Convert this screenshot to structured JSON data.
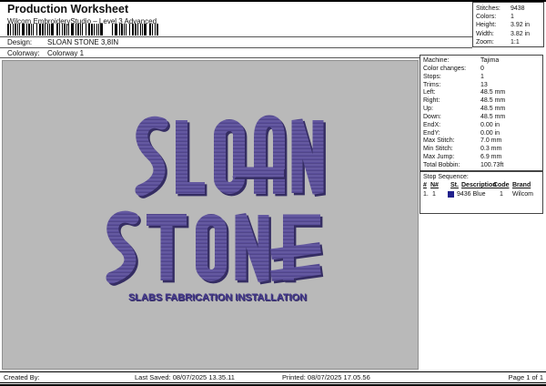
{
  "header": {
    "title": "Production Worksheet",
    "subtitle": "Wilcom EmbroideryStudio – Level 3 Advanced",
    "design_label": "Design:",
    "design_value": "SLOAN STONE 3,8IN",
    "colorway_label": "Colorway:",
    "colorway_value": "Colorway 1"
  },
  "stats_box": {
    "rows": [
      {
        "label": "Stitches:",
        "value": "9438"
      },
      {
        "label": "Colors:",
        "value": "1"
      },
      {
        "label": "Height:",
        "value": "3.92 in"
      },
      {
        "label": "Width:",
        "value": "3.82 in"
      },
      {
        "label": "Zoom:",
        "value": "1:1"
      }
    ]
  },
  "machine_panel": {
    "rows": [
      {
        "label": "Machine:",
        "value": "Tajima"
      },
      {
        "label": "Color changes:",
        "value": "0"
      },
      {
        "label": "Stops:",
        "value": "1"
      },
      {
        "label": "Trims:",
        "value": "13"
      },
      {
        "label": "Left:",
        "value": "48.5 mm"
      },
      {
        "label": "Right:",
        "value": "48.5 mm"
      },
      {
        "label": "Up:",
        "value": "48.5 mm"
      },
      {
        "label": "Down:",
        "value": "48.5 mm"
      },
      {
        "label": "EndX:",
        "value": "0.00 in"
      },
      {
        "label": "EndY:",
        "value": "0.00 in"
      },
      {
        "label": "Max Stitch:",
        "value": "7.0 mm"
      },
      {
        "label": "Min Stitch:",
        "value": "0.3 mm"
      },
      {
        "label": "Max Jump:",
        "value": "6.9 mm"
      },
      {
        "label": "Total Bobbin:",
        "value": "100.73ft"
      }
    ]
  },
  "stop_sequence": {
    "title": "Stop Sequence:",
    "columns": [
      "#",
      "N#",
      "St.",
      "Description",
      "Code",
      "Brand"
    ],
    "row": {
      "index": "1.",
      "needle": "1",
      "swatch_color": "#20208c",
      "description": "9436 Blue",
      "code": "1",
      "brand": "Wilcom"
    }
  },
  "design": {
    "line1": "SLOAN",
    "line2": "STONE",
    "tagline": "SLABS FABRICATION INSTALLATION",
    "thread_color": "#5a4e9a",
    "thread_shadow": "#352d63",
    "tagline_color": "#44398c"
  },
  "footer": {
    "created_by": "Created By:",
    "last_saved": "Last Saved: 08/07/2025 13.35.11",
    "printed": "Printed: 08/07/2025 17.05.56",
    "page": "Page 1 of 1"
  }
}
